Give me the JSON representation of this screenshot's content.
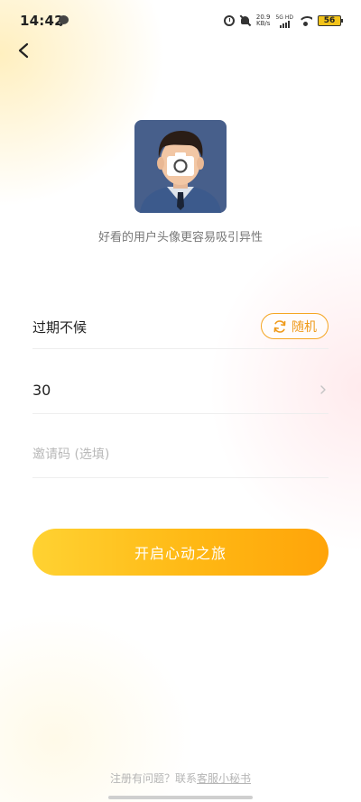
{
  "status_bar": {
    "time": "14:42",
    "net_speed_value": "20.9",
    "net_speed_unit": "KB/s",
    "signal_label": "5G HD",
    "battery": "56"
  },
  "header": {
    "back_icon": "chevron-left-icon"
  },
  "avatar": {
    "overlay_icon": "camera-icon",
    "hint": "好看的用户头像更容易吸引异性"
  },
  "form": {
    "nickname": "过期不候",
    "random_label": "随机",
    "random_icon": "refresh-icon",
    "age": "30",
    "age_chevron_icon": "chevron-right-icon",
    "invite_placeholder": "邀请码 (选填)",
    "invite_value": ""
  },
  "submit_label": "开启心动之旅",
  "footer": {
    "question": "注册有问题？联系",
    "link": "客服小秘书"
  },
  "colors": {
    "accent": "#f5a623",
    "button_start": "#ffd232",
    "button_end": "#ffa409"
  }
}
